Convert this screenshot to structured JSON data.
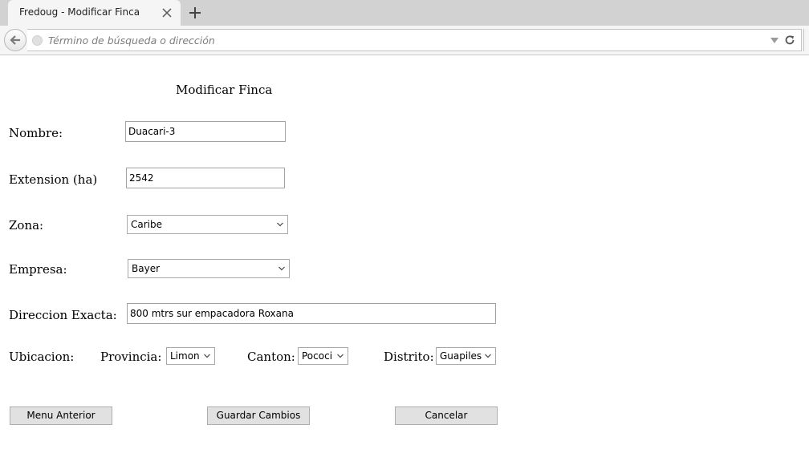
{
  "browser": {
    "tab_title": "Fredoug - Modificar Finca",
    "url_placeholder": "Término de búsqueda o dirección"
  },
  "page": {
    "title": "Modificar Finca"
  },
  "form": {
    "nombre": {
      "label": "Nombre:",
      "value": "Duacari-3"
    },
    "extension": {
      "label": "Extension (ha)",
      "value": "2542"
    },
    "zona": {
      "label": "Zona:",
      "selected": "Caribe"
    },
    "empresa": {
      "label": "Empresa:",
      "selected": "Bayer"
    },
    "direccion": {
      "label": "Direccion Exacta:",
      "value": "800 mtrs sur empacadora Roxana"
    },
    "ubicacion": {
      "label": "Ubicacion:",
      "provincia": {
        "label": "Provincia:",
        "selected": "Limon"
      },
      "canton": {
        "label": "Canton:",
        "selected": "Pococi"
      },
      "distrito": {
        "label": "Distrito:",
        "selected": "Guapiles"
      }
    }
  },
  "buttons": {
    "menu_anterior": "Menu Anterior",
    "guardar_cambios": "Guardar Cambios",
    "cancelar": "Cancelar"
  },
  "icons": {
    "tab_close": "close-icon",
    "new_tab": "plus-icon",
    "back": "back-arrow-icon",
    "site": "globe-icon",
    "dropdown": "dropdown-icon",
    "reload": "reload-icon",
    "select_chevron": "chevron-down-icon"
  }
}
